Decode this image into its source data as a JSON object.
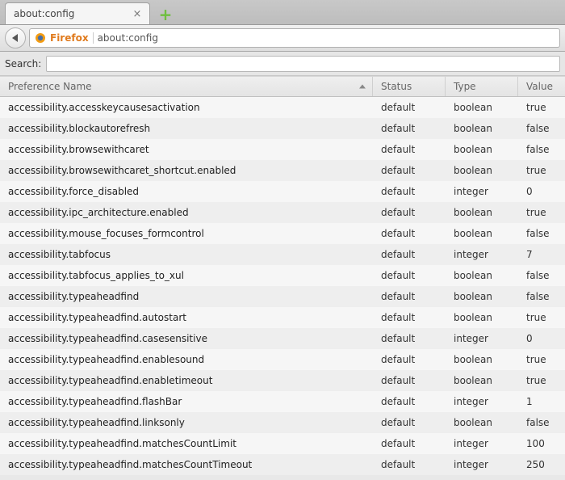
{
  "tab": {
    "title": "about:config"
  },
  "navbar": {
    "identity_label": "Firefox",
    "url": "about:config"
  },
  "search": {
    "label": "Search:",
    "value": ""
  },
  "table": {
    "columns": {
      "name": "Preference Name",
      "status": "Status",
      "type": "Type",
      "value": "Value"
    },
    "rows": [
      {
        "name": "accessibility.accesskeycausesactivation",
        "status": "default",
        "type": "boolean",
        "value": "true"
      },
      {
        "name": "accessibility.blockautorefresh",
        "status": "default",
        "type": "boolean",
        "value": "false"
      },
      {
        "name": "accessibility.browsewithcaret",
        "status": "default",
        "type": "boolean",
        "value": "false"
      },
      {
        "name": "accessibility.browsewithcaret_shortcut.enabled",
        "status": "default",
        "type": "boolean",
        "value": "true"
      },
      {
        "name": "accessibility.force_disabled",
        "status": "default",
        "type": "integer",
        "value": "0"
      },
      {
        "name": "accessibility.ipc_architecture.enabled",
        "status": "default",
        "type": "boolean",
        "value": "true"
      },
      {
        "name": "accessibility.mouse_focuses_formcontrol",
        "status": "default",
        "type": "boolean",
        "value": "false"
      },
      {
        "name": "accessibility.tabfocus",
        "status": "default",
        "type": "integer",
        "value": "7"
      },
      {
        "name": "accessibility.tabfocus_applies_to_xul",
        "status": "default",
        "type": "boolean",
        "value": "false"
      },
      {
        "name": "accessibility.typeaheadfind",
        "status": "default",
        "type": "boolean",
        "value": "false"
      },
      {
        "name": "accessibility.typeaheadfind.autostart",
        "status": "default",
        "type": "boolean",
        "value": "true"
      },
      {
        "name": "accessibility.typeaheadfind.casesensitive",
        "status": "default",
        "type": "integer",
        "value": "0"
      },
      {
        "name": "accessibility.typeaheadfind.enablesound",
        "status": "default",
        "type": "boolean",
        "value": "true"
      },
      {
        "name": "accessibility.typeaheadfind.enabletimeout",
        "status": "default",
        "type": "boolean",
        "value": "true"
      },
      {
        "name": "accessibility.typeaheadfind.flashBar",
        "status": "default",
        "type": "integer",
        "value": "1"
      },
      {
        "name": "accessibility.typeaheadfind.linksonly",
        "status": "default",
        "type": "boolean",
        "value": "false"
      },
      {
        "name": "accessibility.typeaheadfind.matchesCountLimit",
        "status": "default",
        "type": "integer",
        "value": "100"
      },
      {
        "name": "accessibility.typeaheadfind.matchesCountTimeout",
        "status": "default",
        "type": "integer",
        "value": "250"
      }
    ]
  }
}
